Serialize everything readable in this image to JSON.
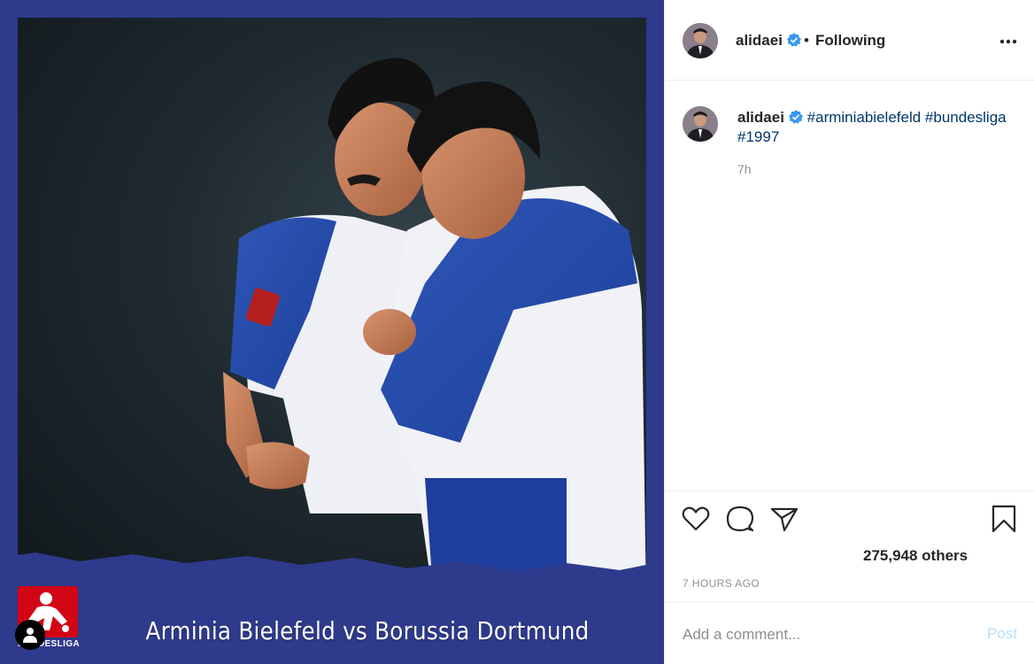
{
  "post": {
    "username": "alidaei",
    "verified": true,
    "follow_state": "Following",
    "separator": "•",
    "more_icon": "more-horizontal-icon",
    "caption": {
      "hashtags": [
        "#arminiabielefeld",
        "#bundesliga",
        "#1997"
      ]
    },
    "time_short": "7h",
    "likes_text": "275,948 others",
    "time_long": "7 HOURS AGO",
    "comment_placeholder": "Add a comment...",
    "post_label": "Post"
  },
  "media": {
    "headline": "Arminia Bielefeld vs Borussia Dortmund",
    "league_logo_text": "BUNDESLIGA",
    "background_color": "#2e3a8c",
    "logo_color": "#d20515"
  },
  "icons": {
    "like": "heart-icon",
    "comment": "comment-bubble-icon",
    "share": "paper-plane-icon",
    "save": "bookmark-icon",
    "verified": "verified-badge-icon",
    "tagged_user": "user-tag-icon"
  },
  "colors": {
    "link": "#00376b",
    "verified_blue": "#3897f0",
    "muted": "#8e8e8e",
    "post_disabled": "#b2dffc"
  }
}
